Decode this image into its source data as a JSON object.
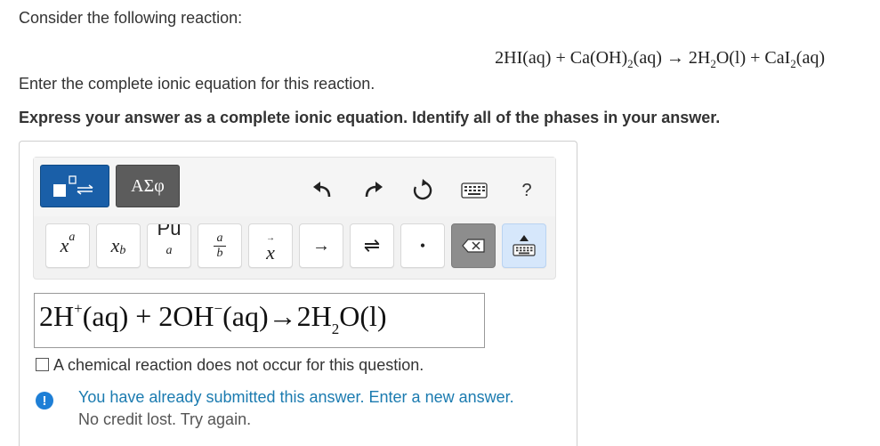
{
  "question": {
    "intro": "Consider the following reaction:",
    "equation": {
      "part1": "2HI(aq) + Ca(OH)",
      "sub1": "2",
      "part2": "(aq) → 2H",
      "sub2": "2",
      "part3": "O(l) + CaI",
      "sub3": "2",
      "part4": "(aq)"
    },
    "prompt": "Enter the complete ionic equation for this reaction.",
    "instruction": "Express your answer as a complete ionic equation. Identify all of the phases in your answer."
  },
  "toolbar": {
    "symbols_label": "ΑΣφ",
    "help_label": "?",
    "keys": {
      "superscript_base": "x",
      "superscript_exp": "a",
      "subscript_base": "x",
      "subscript_exp": "b",
      "nuclide_top": "Pu",
      "nuclide_bottom": "a",
      "fraction_num": "a",
      "fraction_den": "b",
      "vector": "x",
      "arrow": "→",
      "equilibrium": "⇌",
      "dot": "•"
    }
  },
  "answer": {
    "seg1": "2H",
    "sup1": "+",
    "seg2": "(aq) + 2OH",
    "sup2": "−",
    "seg3": "(aq)→2H",
    "sub1": "2",
    "seg4": "O(l)"
  },
  "options": {
    "no_reaction_label": "A chemical reaction does not occur for this question."
  },
  "feedback": {
    "icon": "!",
    "line1": "You have already submitted this answer. Enter a new answer.",
    "line2": "No credit lost. Try again."
  }
}
